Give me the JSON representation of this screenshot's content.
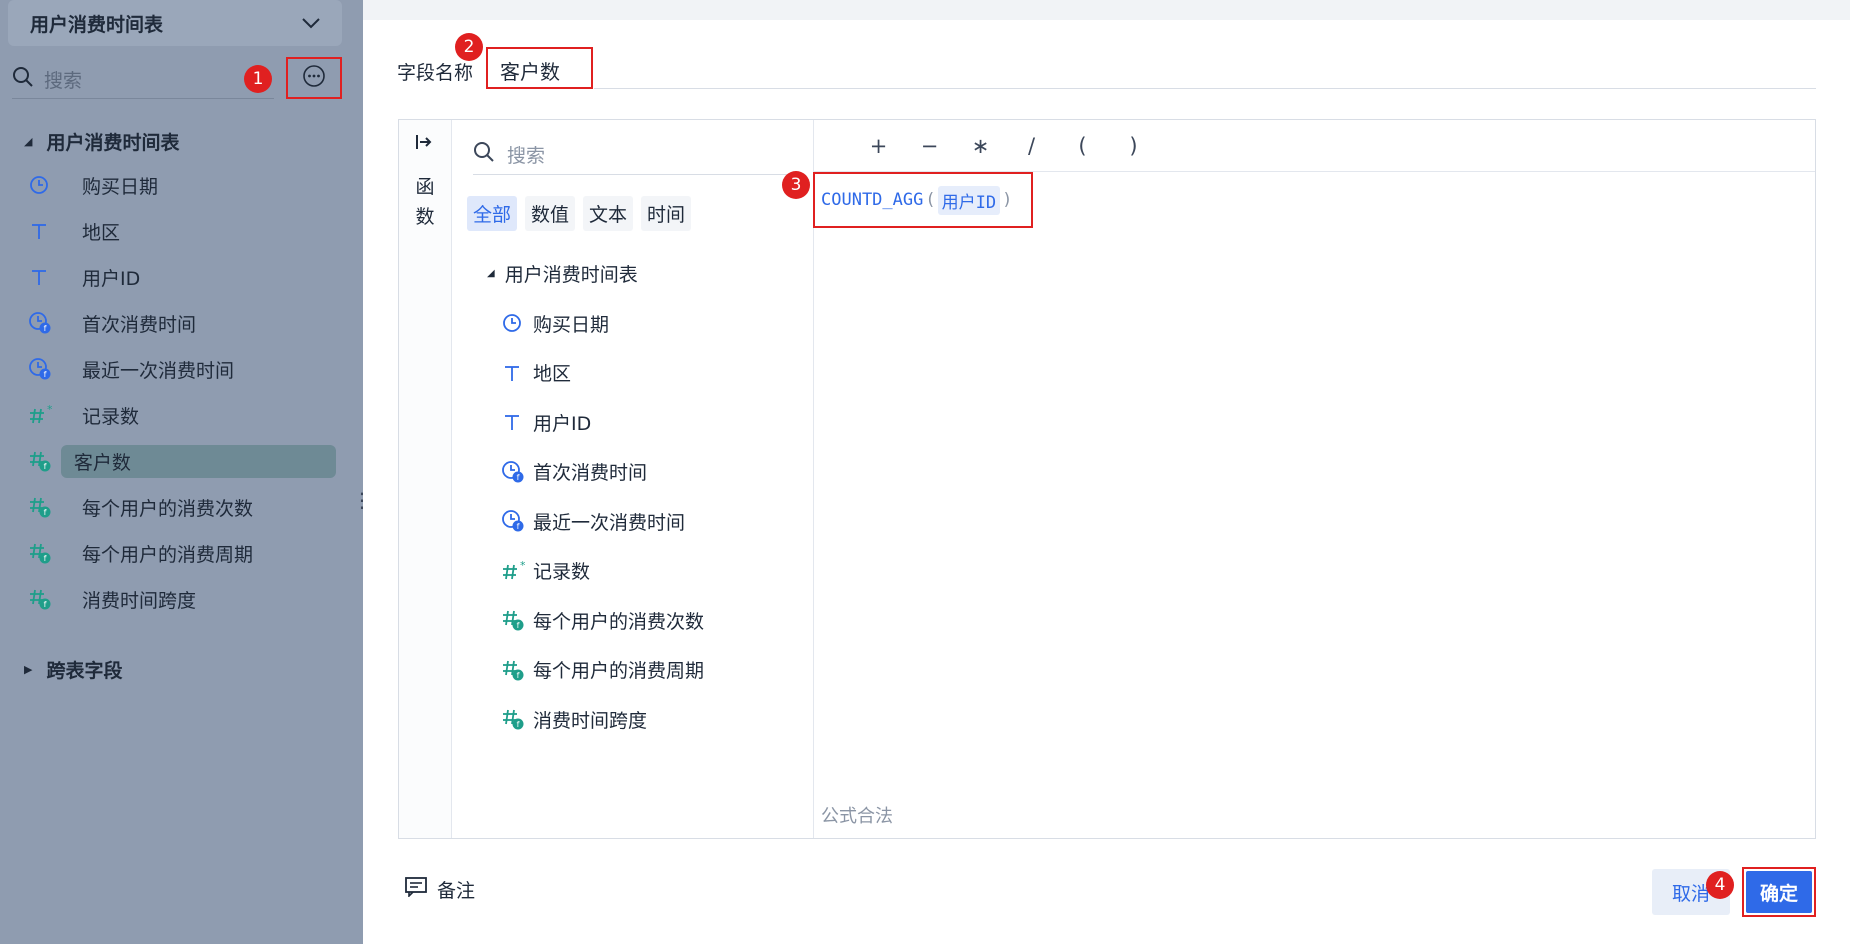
{
  "sidebar": {
    "title": "用户消费时间表",
    "search_placeholder": "搜索",
    "section_label": "用户消费时间表",
    "items": [
      {
        "label": "购买日期",
        "icon": "clock-icon"
      },
      {
        "label": "地区",
        "icon": "text-t-icon"
      },
      {
        "label": "用户ID",
        "icon": "text-t-icon"
      },
      {
        "label": "首次消费时间",
        "icon": "clock-function-icon"
      },
      {
        "label": "最近一次消费时间",
        "icon": "clock-function-icon"
      },
      {
        "label": "记录数",
        "icon": "hash-star-icon"
      },
      {
        "label": "客户数",
        "icon": "hash-function-icon",
        "selected": true
      },
      {
        "label": "每个用户的消费次数",
        "icon": "hash-function-icon"
      },
      {
        "label": "每个用户的消费周期",
        "icon": "hash-function-icon"
      },
      {
        "label": "消费时间跨度",
        "icon": "hash-function-icon"
      }
    ],
    "cross_section_label": "跨表字段"
  },
  "field": {
    "label": "字段名称",
    "value": "客户数"
  },
  "editor": {
    "rail_label": "函数",
    "search_placeholder": "搜索",
    "tabs": [
      "全部",
      "数值",
      "文本",
      "时间"
    ],
    "active_tab": "全部",
    "section_label": "用户消费时间表",
    "items": [
      {
        "label": "购买日期",
        "icon": "clock-icon"
      },
      {
        "label": "地区",
        "icon": "text-t-icon"
      },
      {
        "label": "用户ID",
        "icon": "text-t-icon"
      },
      {
        "label": "首次消费时间",
        "icon": "clock-function-icon"
      },
      {
        "label": "最近一次消费时间",
        "icon": "clock-function-icon"
      },
      {
        "label": "记录数",
        "icon": "hash-star-icon"
      },
      {
        "label": "每个用户的消费次数",
        "icon": "hash-function-icon"
      },
      {
        "label": "每个用户的消费周期",
        "icon": "hash-function-icon"
      },
      {
        "label": "消费时间跨度",
        "icon": "hash-function-icon"
      }
    ],
    "operators": [
      "+",
      "−",
      "∗",
      "/",
      "(",
      ")"
    ],
    "formula": {
      "function": "COUNTD_AGG",
      "open_paren": "(",
      "field_ref": "用户ID",
      "close_paren": ")"
    },
    "status": "公式合法"
  },
  "footer": {
    "note_label": "备注",
    "cancel_label": "取消",
    "confirm_label": "确定"
  },
  "markers": [
    "1",
    "2",
    "3",
    "4"
  ],
  "colors": {
    "accent": "#2f6ae8",
    "highlight": "#e02020",
    "sidebar_bg": "#8f9cb0",
    "teal_icon": "#1f9e8a"
  }
}
